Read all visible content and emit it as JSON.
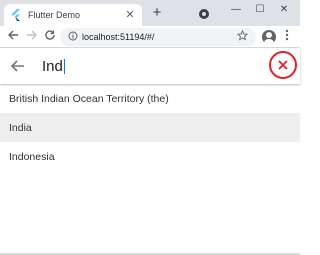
{
  "browser": {
    "tab_title": "Flutter Demo",
    "tab_close_glyph": "✕",
    "new_tab_glyph": "+",
    "window_controls": [
      "—",
      "☐",
      "✕"
    ],
    "address_url": "localhost:51194/#/",
    "icons": {
      "favicon": "flutter-logo-icon",
      "back": "back-arrow-icon",
      "forward": "forward-arrow-icon",
      "reload": "reload-icon",
      "info": "info-icon",
      "bookmark": "star-icon",
      "profile": "account-icon",
      "menu": "more-vert-icon"
    }
  },
  "search": {
    "query": "Ind",
    "back_icon": "arrow-back-icon",
    "clear_icon": "close-icon",
    "clear_glyph": "✕",
    "accent_color": "#e0202a"
  },
  "results": [
    {
      "label": "British Indian Ocean Territory (the)",
      "highlighted": false
    },
    {
      "label": "India",
      "highlighted": true
    },
    {
      "label": "Indonesia",
      "highlighted": false
    }
  ]
}
